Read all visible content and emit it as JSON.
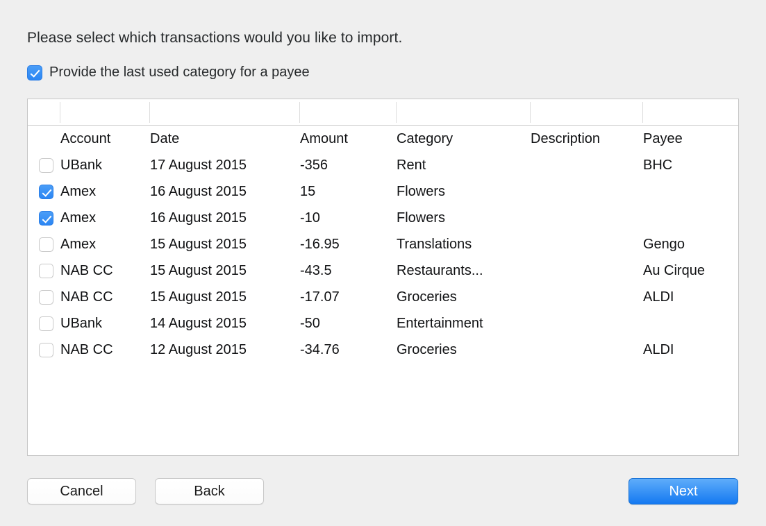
{
  "dialog": {
    "prompt": "Please select which transactions would you like to import."
  },
  "options": {
    "provide_last_category": {
      "label": "Provide the last used category for a payee",
      "checked": true
    }
  },
  "table": {
    "columns": [
      "",
      "Account",
      "Date",
      "Amount",
      "Category",
      "Description",
      "Payee"
    ],
    "rows": [
      {
        "selected": false,
        "account": "UBank",
        "date": "17 August 2015",
        "amount": "-356",
        "category": "Rent",
        "description": "",
        "payee": "BHC"
      },
      {
        "selected": true,
        "account": "Amex",
        "date": "16 August 2015",
        "amount": "15",
        "category": "Flowers",
        "description": "",
        "payee": ""
      },
      {
        "selected": true,
        "account": "Amex",
        "date": "16 August 2015",
        "amount": "-10",
        "category": "Flowers",
        "description": "",
        "payee": ""
      },
      {
        "selected": false,
        "account": "Amex",
        "date": "15 August 2015",
        "amount": "-16.95",
        "category": "Translations",
        "description": "",
        "payee": "Gengo"
      },
      {
        "selected": false,
        "account": "NAB CC",
        "date": "15 August 2015",
        "amount": "-43.5",
        "category": "Restaurants...",
        "description": "",
        "payee": "Au Cirque"
      },
      {
        "selected": false,
        "account": "NAB CC",
        "date": "15 August 2015",
        "amount": "-17.07",
        "category": "Groceries",
        "description": "",
        "payee": "ALDI"
      },
      {
        "selected": false,
        "account": "UBank",
        "date": "14 August 2015",
        "amount": "-50",
        "category": "Entertainment",
        "description": "",
        "payee": ""
      },
      {
        "selected": false,
        "account": "NAB CC",
        "date": "12 August 2015",
        "amount": "-34.76",
        "category": "Groceries",
        "description": "",
        "payee": "ALDI"
      }
    ]
  },
  "buttons": {
    "cancel": "Cancel",
    "back": "Back",
    "next": "Next"
  },
  "colors": {
    "background": "#efefef",
    "accent": "#2b86f3",
    "panel": "#ffffff",
    "border": "#c6c6c6"
  }
}
